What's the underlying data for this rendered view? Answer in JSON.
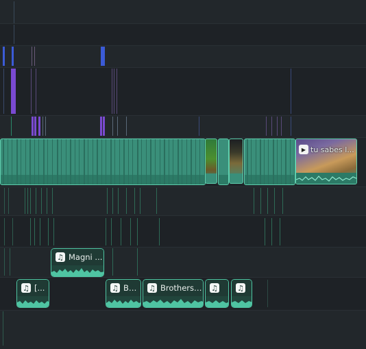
{
  "timeline": {
    "colors": {
      "background": "#1e2226",
      "video_clip": "#3a8f7a",
      "clip_border": "#5fcfae",
      "audio_clip": "#21453c",
      "marker_blue": "#3b5bd6",
      "marker_purple": "#7a4ad1"
    },
    "video_track": {
      "title_clip": {
        "label": "tu sabes l...",
        "icon": "play-icon"
      }
    },
    "audio_track_1": {
      "clip_1": {
        "label": "Magni ...",
        "icon": "music-note-icon"
      }
    },
    "audio_track_2": {
      "clip_1": {
        "label": "[...",
        "icon": "music-note-icon"
      },
      "clip_2": {
        "label": "Bu...",
        "icon": "music-note-icon"
      },
      "clip_3": {
        "label": "Brothers ...",
        "icon": "music-note-icon"
      },
      "clip_4": {
        "label": "",
        "icon": "music-note-icon"
      },
      "clip_5": {
        "label": "",
        "icon": "music-note-icon"
      }
    }
  }
}
